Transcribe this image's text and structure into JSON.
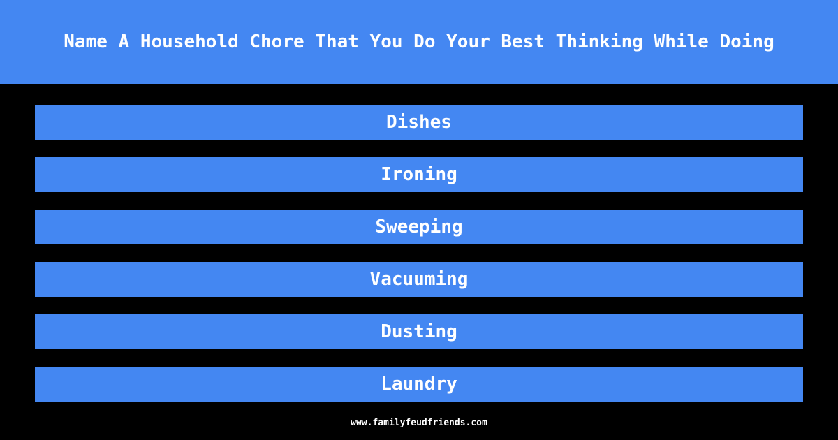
{
  "question": "Name A Household Chore That You Do Your Best Thinking While Doing",
  "answers": [
    "Dishes",
    "Ironing",
    "Sweeping",
    "Vacuuming",
    "Dusting",
    "Laundry"
  ],
  "footer": "www.familyfeudfriends.com",
  "colors": {
    "accent": "#4487f2",
    "background": "#000000",
    "text": "#ffffff"
  }
}
